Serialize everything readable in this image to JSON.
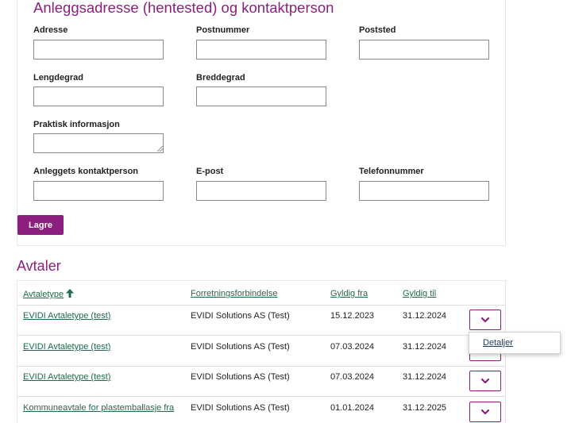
{
  "address_section": {
    "title": "Anleggsadresse (hentested) og kontaktperson",
    "fields": {
      "adresse": {
        "label": "Adresse",
        "value": ""
      },
      "postnummer": {
        "label": "Postnummer",
        "value": ""
      },
      "poststed": {
        "label": "Poststed",
        "value": ""
      },
      "lengdegrad": {
        "label": "Lengdegrad",
        "value": ""
      },
      "breddegrad": {
        "label": "Breddegrad",
        "value": ""
      },
      "praktisk": {
        "label": "Praktisk informasjon",
        "value": ""
      },
      "kontaktperson": {
        "label": "Anleggets kontaktperson",
        "value": ""
      },
      "epost": {
        "label": "E-post",
        "value": ""
      },
      "telefon": {
        "label": "Telefonnummer",
        "value": ""
      }
    },
    "save_label": "Lagre"
  },
  "agreements": {
    "title": "Avtaler",
    "columns": [
      "Avtaletype",
      "Forretningsforbindelse",
      "Gyldig fra",
      "Gyldig til"
    ],
    "sort_icon": "arrow-up-icon",
    "rows": [
      {
        "type": "EVIDI Avtaletype (test)",
        "partner": "EVIDI Solutions AS (Test)",
        "from": "15.12.2023",
        "to": "31.12.2024"
      },
      {
        "type": "EVIDI Avtaletype (test)",
        "partner": "EVIDI Solutions AS (Test)",
        "from": "07.03.2024",
        "to": "31.12.2024"
      },
      {
        "type": "EVIDI Avtaletype (test)",
        "partner": "EVIDI Solutions AS (Test)",
        "from": "07.03.2024",
        "to": "31.12.2024"
      },
      {
        "type": "Kommuneavtale for plastemballasje fra",
        "partner": "EVIDI Solutions AS (Test)",
        "from": "01.01.2024",
        "to": "31.12.2025"
      }
    ],
    "row_action_icon": "chevron-down-icon",
    "popup_item": "Detaljer"
  },
  "colors": {
    "accent": "#8b1f7e",
    "link": "#1f6b4a"
  }
}
